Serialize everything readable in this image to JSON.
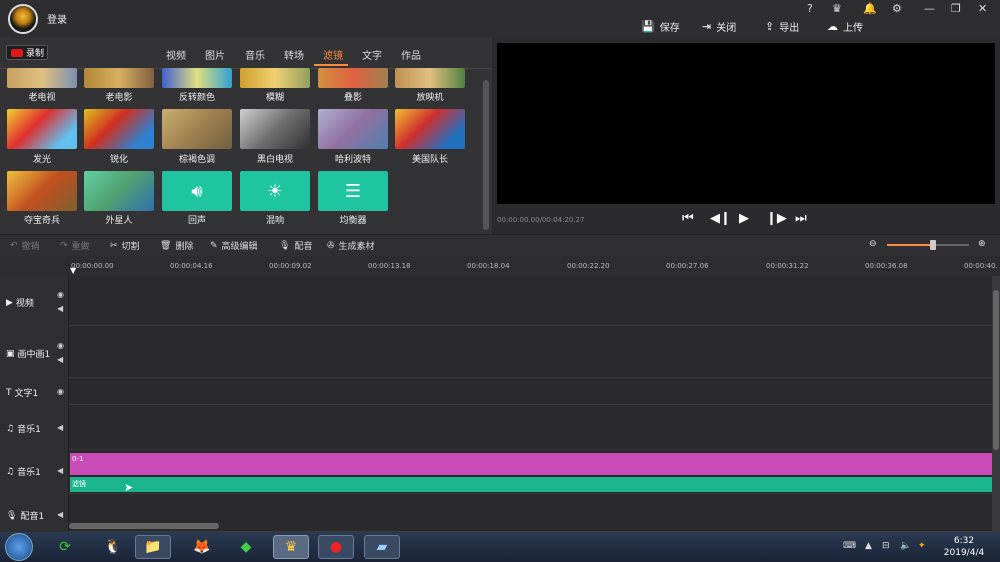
{
  "header": {
    "login_label": "登录",
    "help": "?",
    "actions": [
      {
        "icon": "save-icon",
        "glyph": "💾",
        "label": "保存"
      },
      {
        "icon": "exit-icon",
        "glyph": "⇥",
        "label": "关闭"
      },
      {
        "icon": "export-icon",
        "glyph": "⇪",
        "label": "导出"
      },
      {
        "icon": "upload-icon",
        "glyph": "☁",
        "label": "上传"
      }
    ]
  },
  "record_label": "录制",
  "tabs": [
    "视频",
    "图片",
    "音乐",
    "转场",
    "滤镜",
    "文字",
    "作品"
  ],
  "active_tab": "滤镜",
  "filters_row0": [
    "老电视",
    "老电影",
    "反转颜色",
    "模糊",
    "叠影",
    "放映机"
  ],
  "filters_row1": [
    "发光",
    "锐化",
    "棕褐色调",
    "黑白电视",
    "哈利波特",
    "美国队长"
  ],
  "filters_row2": [
    "夺宝奇兵",
    "外星人",
    "回声",
    "混响",
    "均衡器"
  ],
  "preview": {
    "time": "00:00:00.00/00:04:20.27"
  },
  "toolbar": {
    "undo": "撤销",
    "redo": "重做",
    "cut": "切割",
    "delete": "删除",
    "advanced_edit": "高级编辑",
    "dub": "配音",
    "generate": "生成素材"
  },
  "ruler": [
    "00:00:00.00",
    "00:00:04.16",
    "00:00:09.02",
    "00:00:13.18",
    "00:00:18.04",
    "00:00:22.20",
    "00:00:27.06",
    "00:00:31.22",
    "00:00:36.08",
    "00:00:40."
  ],
  "tracks": [
    "视频",
    "画中画1",
    "文字1",
    "音乐1",
    "音乐1",
    "配音1"
  ],
  "clips": {
    "a": "0-1",
    "b": "滤镜"
  },
  "taskbar": {
    "time": "6:32",
    "date": "2019/4/4"
  },
  "colors": {
    "accent": "#ff8a3c",
    "teal": "#1fc4a0",
    "clip_pink": "#c94bb8",
    "clip_green": "#1ab58a"
  }
}
